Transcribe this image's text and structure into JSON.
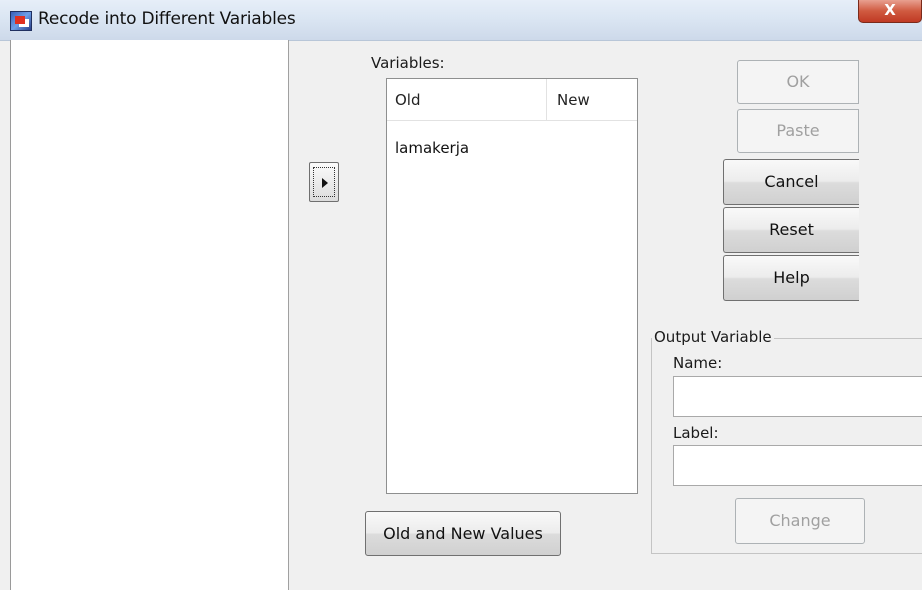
{
  "window": {
    "title": "Recode into Different Variables",
    "close_label": "X"
  },
  "variables": {
    "label": "Variables:",
    "columns": [
      "Old",
      "New"
    ],
    "rows": [
      {
        "old": "lamakerja",
        "new": ""
      }
    ]
  },
  "move_button": {
    "icon": "right-arrow-icon"
  },
  "buttons": {
    "ok": "OK",
    "paste": "Paste",
    "cancel": "Cancel",
    "reset": "Reset",
    "help": "Help",
    "old_new_values": "Old and New Values",
    "change": "Change"
  },
  "output_variable": {
    "legend": "Output Variable",
    "name_label": "Name:",
    "name_value": "",
    "label_label": "Label:",
    "label_value": ""
  }
}
